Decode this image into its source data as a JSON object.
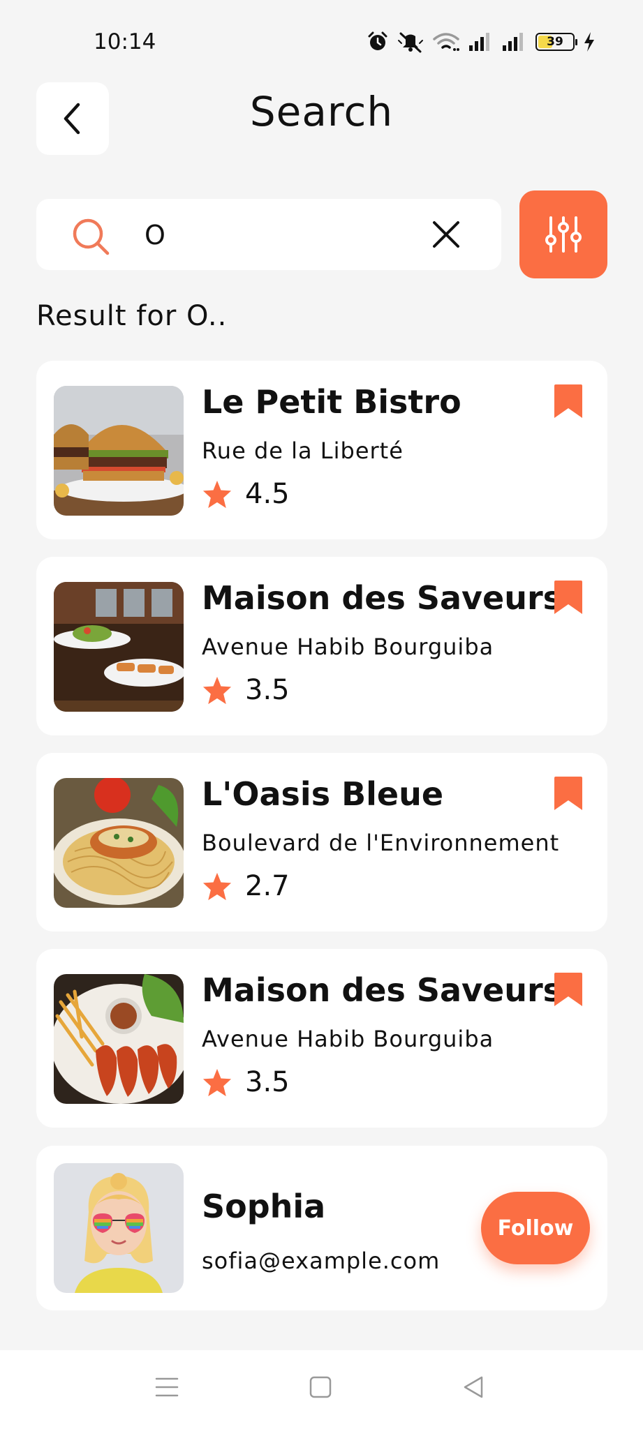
{
  "status_bar": {
    "time": "10:14",
    "battery": "39",
    "icons": [
      "alarm-icon",
      "mute-icon",
      "wifi-icon",
      "signal-icon",
      "signal-icon",
      "battery-icon",
      "charging-icon"
    ]
  },
  "header": {
    "title": "Search",
    "back_icon": "chevron-left-icon"
  },
  "search": {
    "query": "O",
    "icon": "search-icon",
    "clear_icon": "close-icon",
    "filter_icon": "sliders-icon"
  },
  "result_label": "Result for O..",
  "accent_color": "#fb6e43",
  "restaurants": [
    {
      "name": "Le Petit Bistro",
      "address": "Rue de la Liberté",
      "rating": "4.5",
      "image": "burger"
    },
    {
      "name": "Maison des Saveurs",
      "address": "Avenue Habib Bourguiba",
      "rating": "3.5",
      "image": "restaurant-dishes"
    },
    {
      "name": "L'Oasis Bleue",
      "address": "Boulevard de l'Environnement",
      "rating": "2.7",
      "image": "spaghetti"
    },
    {
      "name": "Maison des Saveurs",
      "address": "Avenue Habib Bourguiba",
      "rating": "3.5",
      "image": "shrimp-fries"
    }
  ],
  "user": {
    "name": "Sophia",
    "email": "sofia@example.com",
    "follow_label": "Follow"
  },
  "nav": {
    "items": [
      "menu-icon",
      "home-icon",
      "back-icon"
    ]
  }
}
